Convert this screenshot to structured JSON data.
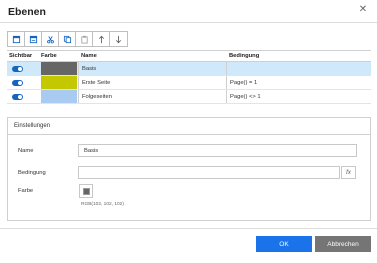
{
  "dialog": {
    "title": "Ebenen",
    "close_icon": "close-icon"
  },
  "toolbar": {
    "buttons": [
      {
        "icon": "new-layer-icon"
      },
      {
        "icon": "layer-properties-icon"
      },
      {
        "icon": "cut-icon"
      },
      {
        "icon": "copy-icon"
      },
      {
        "icon": "paste-icon"
      },
      {
        "icon": "arrow-up-icon"
      },
      {
        "icon": "arrow-down-icon"
      }
    ]
  },
  "table": {
    "headers": [
      "Sichtbar",
      "Farbe",
      "Name",
      "Bedingung"
    ],
    "rows": [
      {
        "visible": true,
        "color": "#666666",
        "name": "Basis",
        "condition": ""
      },
      {
        "visible": true,
        "color": "#c3c800",
        "name": "Erste Seite",
        "condition": "Page() = 1"
      },
      {
        "visible": true,
        "color": "#a9cbf2",
        "name": "Folgeseiten",
        "condition": "Page() <> 1"
      }
    ],
    "selected_row": 0
  },
  "settings": {
    "heading": "Einstellungen",
    "name_label": "Name",
    "name_value": "Basis",
    "condition_label": "Bedingung",
    "condition_value": "",
    "fx_label": "fx",
    "color_label": "Farbe",
    "color_value": "#666666",
    "rgb_text": "RGB(102, 102, 102)"
  },
  "footer": {
    "ok_label": "OK",
    "cancel_label": "Abbrechen"
  },
  "colors": {
    "accent": "#1a73e8",
    "selected_row": "#cfe9fb",
    "toggle_on": "#1565c0",
    "cancel_bg": "#757575"
  }
}
